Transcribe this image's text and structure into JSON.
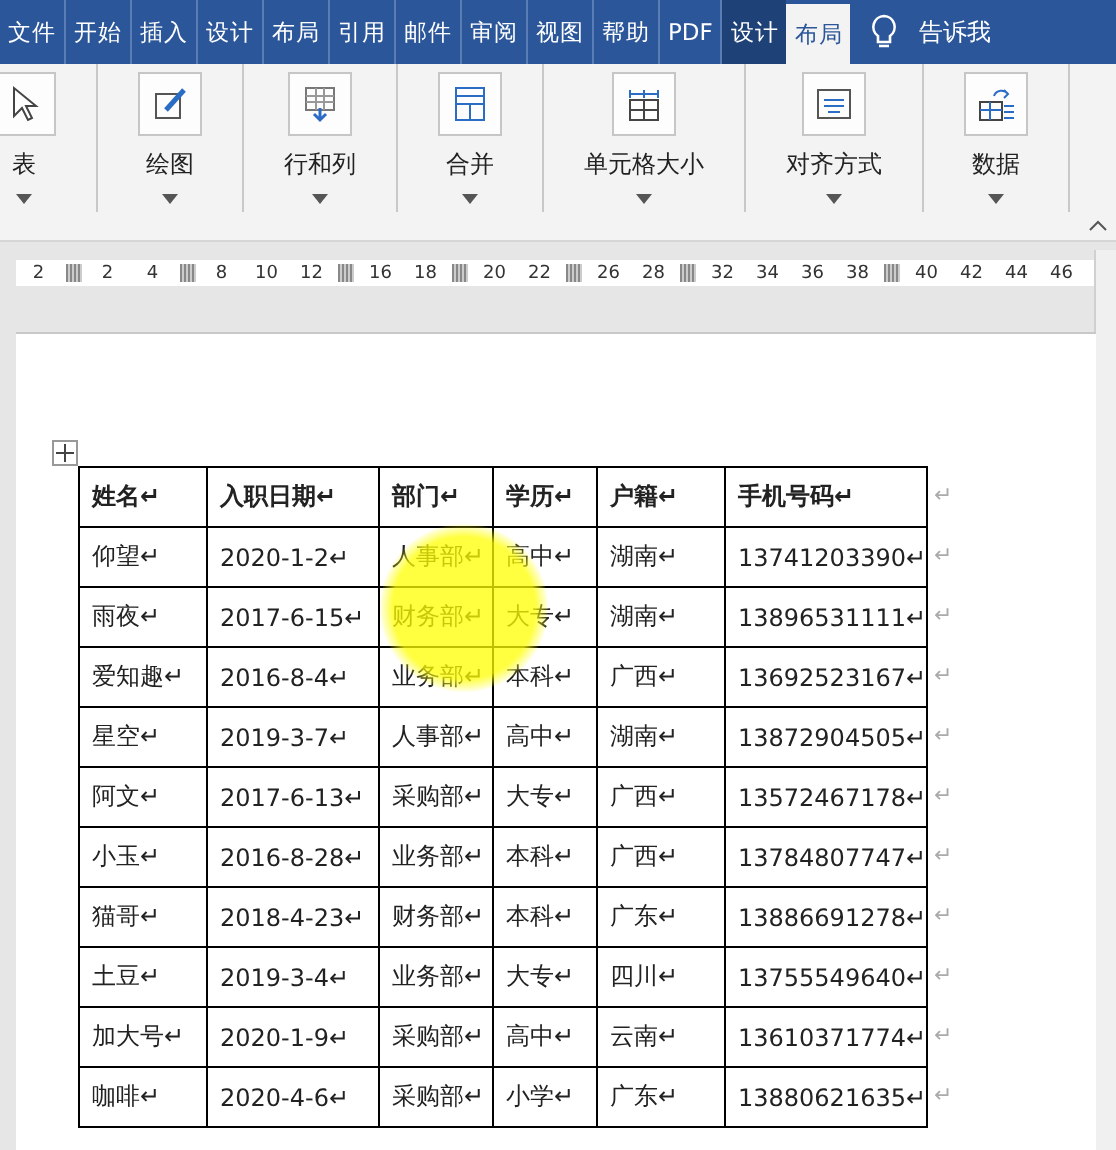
{
  "tabs": [
    {
      "label": "文件",
      "selected": false,
      "kind": "tab"
    },
    {
      "label": "开始",
      "selected": false,
      "kind": "tab"
    },
    {
      "label": "插入",
      "selected": false,
      "kind": "tab"
    },
    {
      "label": "设计",
      "selected": false,
      "kind": "tab"
    },
    {
      "label": "布局",
      "selected": false,
      "kind": "tab"
    },
    {
      "label": "引用",
      "selected": false,
      "kind": "tab"
    },
    {
      "label": "邮件",
      "selected": false,
      "kind": "tab"
    },
    {
      "label": "审阅",
      "selected": false,
      "kind": "tab"
    },
    {
      "label": "视图",
      "selected": false,
      "kind": "tab"
    },
    {
      "label": "帮助",
      "selected": false,
      "kind": "tab"
    },
    {
      "label": "PDF",
      "selected": false,
      "kind": "tab"
    },
    {
      "label": "设计",
      "selected": false,
      "kind": "context"
    },
    {
      "label": "布局",
      "selected": true,
      "kind": "context"
    }
  ],
  "tell_me": "告诉我",
  "ribbon_groups": [
    {
      "label": "表"
    },
    {
      "label": "绘图"
    },
    {
      "label": "行和列"
    },
    {
      "label": "合并"
    },
    {
      "label": "单元格大小"
    },
    {
      "label": "对齐方式"
    },
    {
      "label": "数据"
    }
  ],
  "ruler": [
    {
      "kind": "label",
      "text": "2"
    },
    {
      "kind": "marker"
    },
    {
      "kind": "label",
      "text": "2"
    },
    {
      "kind": "label",
      "text": "4"
    },
    {
      "kind": "marker"
    },
    {
      "kind": "label",
      "text": "8"
    },
    {
      "kind": "label",
      "text": "10"
    },
    {
      "kind": "label",
      "text": "12"
    },
    {
      "kind": "marker"
    },
    {
      "kind": "label",
      "text": "16"
    },
    {
      "kind": "label",
      "text": "18"
    },
    {
      "kind": "marker"
    },
    {
      "kind": "label",
      "text": "20"
    },
    {
      "kind": "label",
      "text": "22"
    },
    {
      "kind": "marker"
    },
    {
      "kind": "label",
      "text": "26"
    },
    {
      "kind": "label",
      "text": "28"
    },
    {
      "kind": "marker"
    },
    {
      "kind": "label",
      "text": "32"
    },
    {
      "kind": "label",
      "text": "34"
    },
    {
      "kind": "label",
      "text": "36"
    },
    {
      "kind": "label",
      "text": "38"
    },
    {
      "kind": "marker"
    },
    {
      "kind": "label",
      "text": "40"
    },
    {
      "kind": "label",
      "text": "42"
    },
    {
      "kind": "label",
      "text": "44"
    },
    {
      "kind": "label",
      "text": "46"
    }
  ],
  "table": {
    "header": [
      "姓名↵",
      "入职日期↵",
      "部门↵",
      "学历↵",
      "户籍↵",
      "手机号码↵"
    ],
    "rows": [
      [
        "仰望↵",
        "2020-1-2↵",
        "人事部↵",
        "高中↵",
        "湖南↵",
        "13741203390↵"
      ],
      [
        "雨夜↵",
        "2017-6-15↵",
        "财务部↵",
        "大专↵",
        "湖南↵",
        "13896531111↵"
      ],
      [
        "爱知趣↵",
        "2016-8-4↵",
        "业务部↵",
        "本科↵",
        "广西↵",
        "13692523167↵"
      ],
      [
        "星空↵",
        "2019-3-7↵",
        "人事部↵",
        "高中↵",
        "湖南↵",
        "13872904505↵"
      ],
      [
        "阿文↵",
        "2017-6-13↵",
        "采购部↵",
        "大专↵",
        "广西↵",
        "13572467178↵"
      ],
      [
        "小玉↵",
        "2016-8-28↵",
        "业务部↵",
        "本科↵",
        "广西↵",
        "13784807747↵"
      ],
      [
        "猫哥↵",
        "2018-4-23↵",
        "财务部↵",
        "本科↵",
        "广东↵",
        "13886691278↵"
      ],
      [
        "土豆↵",
        "2019-3-4↵",
        "业务部↵",
        "大专↵",
        "四川↵",
        "13755549640↵"
      ],
      [
        "加大号↵",
        "2020-1-9↵",
        "采购部↵",
        "高中↵",
        "云南↵",
        "13610371774↵"
      ],
      [
        "咖啡↵",
        "2020-4-6↵",
        "采购部↵",
        "小学↵",
        "广东↵",
        "13880621635↵"
      ]
    ],
    "row_end_mark": "↵"
  }
}
